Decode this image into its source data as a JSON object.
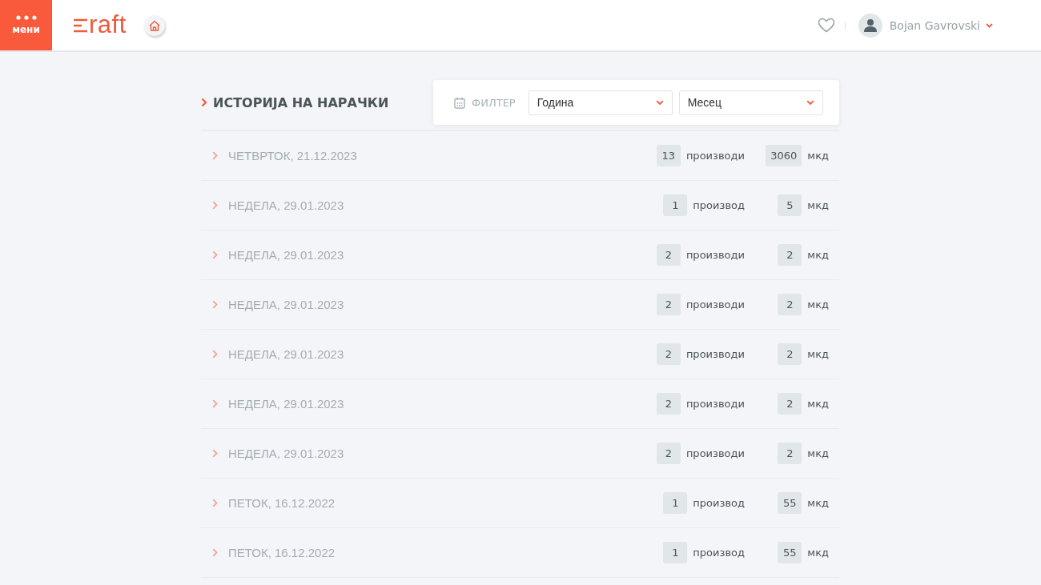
{
  "header": {
    "menu_label": "мени",
    "logo_text": "raft",
    "user_name": "Bojan Gavrovski"
  },
  "title": "ИСТОРИЈА НА НАРАЧКИ",
  "filter": {
    "label": "ФИЛТЕР",
    "selects": [
      {
        "value": "Година"
      },
      {
        "value": "Месец"
      }
    ]
  },
  "orders": [
    {
      "date": "ЧЕТВРТОК, 21.12.2023",
      "count": "13",
      "count_unit": "производи",
      "amount": "3060",
      "currency": "мкд"
    },
    {
      "date": "НЕДЕЛА, 29.01.2023",
      "count": "1",
      "count_unit": "производ",
      "amount": "5",
      "currency": "мкд"
    },
    {
      "date": "НЕДЕЛА, 29.01.2023",
      "count": "2",
      "count_unit": "производи",
      "amount": "2",
      "currency": "мкд"
    },
    {
      "date": "НЕДЕЛА, 29.01.2023",
      "count": "2",
      "count_unit": "производи",
      "amount": "2",
      "currency": "мкд"
    },
    {
      "date": "НЕДЕЛА, 29.01.2023",
      "count": "2",
      "count_unit": "производи",
      "amount": "2",
      "currency": "мкд"
    },
    {
      "date": "НЕДЕЛА, 29.01.2023",
      "count": "2",
      "count_unit": "производи",
      "amount": "2",
      "currency": "мкд"
    },
    {
      "date": "НЕДЕЛА, 29.01.2023",
      "count": "2",
      "count_unit": "производи",
      "amount": "2",
      "currency": "мкд"
    },
    {
      "date": "ПЕТОК, 16.12.2022",
      "count": "1",
      "count_unit": "производ",
      "amount": "55",
      "currency": "мкд"
    },
    {
      "date": "ПЕТОК, 16.12.2022",
      "count": "1",
      "count_unit": "производ",
      "amount": "55",
      "currency": "мкд"
    }
  ]
}
